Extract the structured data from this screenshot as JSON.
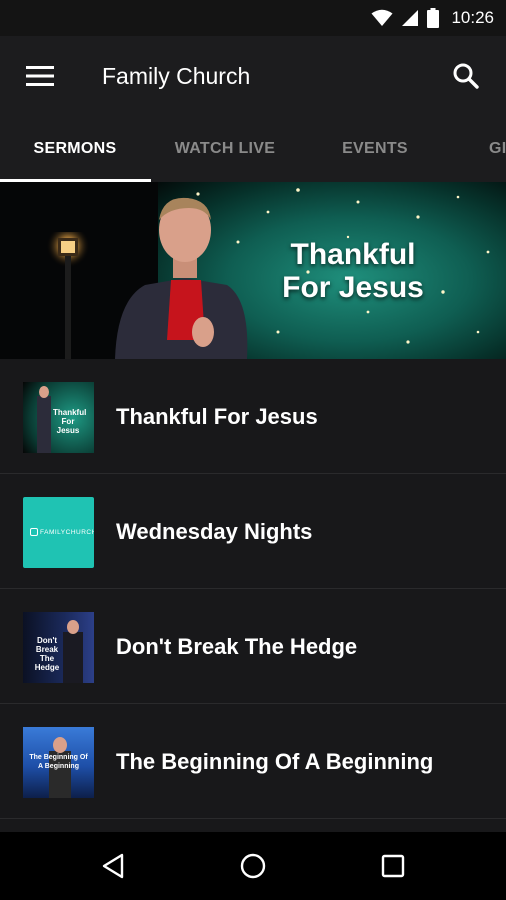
{
  "status_bar": {
    "time": "10:26"
  },
  "app_bar": {
    "title": "Family Church"
  },
  "tabs": [
    {
      "label": "SERMONS",
      "active": true
    },
    {
      "label": "WATCH LIVE",
      "active": false
    },
    {
      "label": "EVENTS",
      "active": false
    },
    {
      "label": "GI",
      "active": false
    }
  ],
  "hero": {
    "title": "Thankful For Jesus"
  },
  "sermons": [
    {
      "title": "Thankful For Jesus",
      "thumb_label": "Thankful For Jesus",
      "thumb_color": "#0d5c4e"
    },
    {
      "title": "Wednesday Nights",
      "thumb_label": "FAMILYCHURCH",
      "thumb_color": "#1fc3b3"
    },
    {
      "title": "Don't Break The Hedge",
      "thumb_label": "Don't Break The Hedge",
      "thumb_color": "#1b2a5c"
    },
    {
      "title": "The Beginning Of A Beginning",
      "thumb_label": "The Beginning Of A Beginning",
      "thumb_color": "#1e4fa8"
    }
  ],
  "colors": {
    "background": "#18181a",
    "app_bar": "#1c1c1e",
    "accent": "#ffffff",
    "inactive_tab": "#8a8a8a"
  }
}
